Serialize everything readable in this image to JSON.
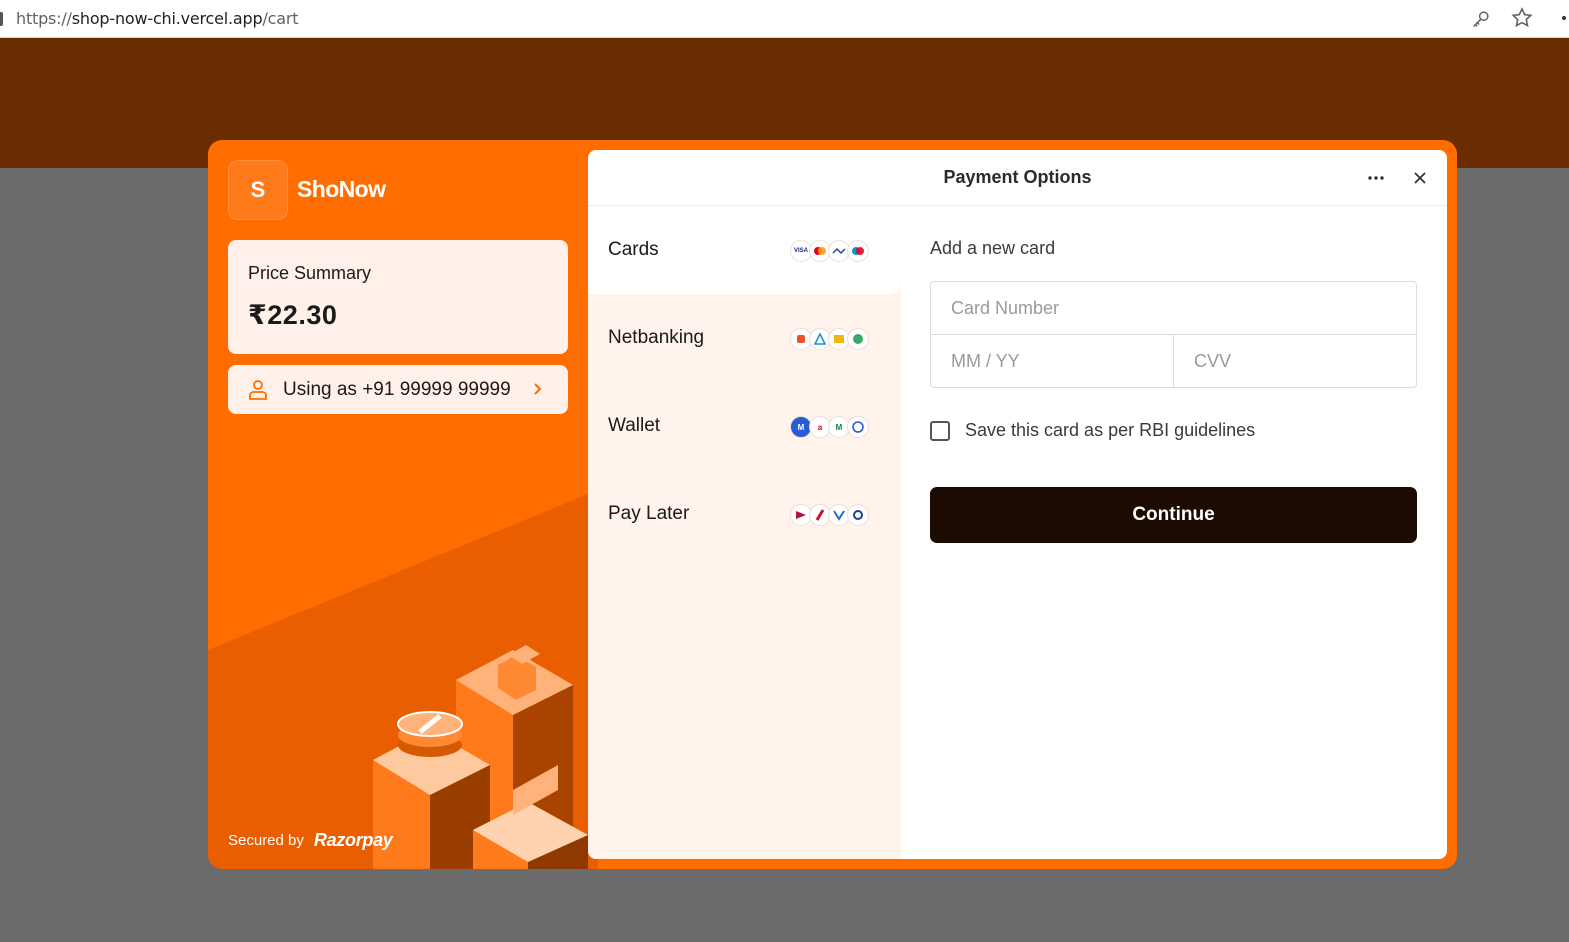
{
  "browser": {
    "url_proto": "https://",
    "url_host": "shop-now-chi.vercel.app",
    "url_path": "/cart"
  },
  "merchant": {
    "logo_letter": "S",
    "name": "ShoNow"
  },
  "price_summary": {
    "label": "Price Summary",
    "amount": "₹22.30"
  },
  "user": {
    "text": "Using as +91 99999 99999"
  },
  "footer": {
    "secured_by": "Secured by",
    "provider": "Razorpay"
  },
  "panel": {
    "title": "Payment Options"
  },
  "methods": [
    {
      "label": "Cards",
      "icons": [
        "visa-icon",
        "mastercard-icon",
        "rupay-icon",
        "maestro-icon"
      ]
    },
    {
      "label": "Netbanking",
      "icons": [
        "bank-1-icon",
        "bank-2-icon",
        "bank-3-icon",
        "bank-4-icon"
      ]
    },
    {
      "label": "Wallet",
      "icons": [
        "mobikwik-icon",
        "airtel-icon",
        "wallet-m-icon",
        "wallet-shield-icon"
      ]
    },
    {
      "label": "Pay Later",
      "icons": [
        "paylater-1-icon",
        "paylater-2-icon",
        "paylater-3-icon",
        "paylater-4-icon"
      ]
    }
  ],
  "card_form": {
    "heading": "Add a new card",
    "card_number_placeholder": "Card Number",
    "expiry_placeholder": "MM / YY",
    "cvv_placeholder": "CVV",
    "save_label": "Save this card as per RBI guidelines",
    "continue_label": "Continue"
  },
  "colors": {
    "brand_orange": "#ff6d00",
    "header_brown": "#692d01",
    "continue_dark": "#1c0b02",
    "methods_bg": "#fff3ec"
  }
}
